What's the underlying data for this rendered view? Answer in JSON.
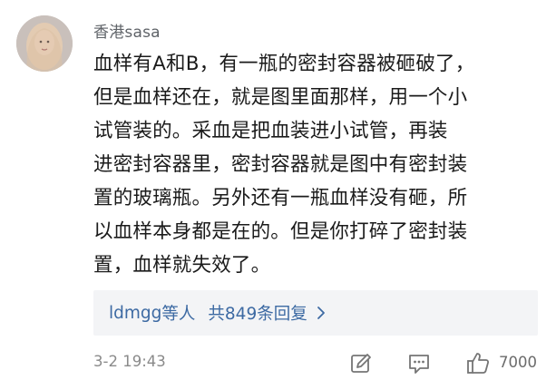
{
  "comment": {
    "username": "香港sasa",
    "lines": [
      "血样有A和B，有一瓶的密封容器被砸破了，",
      "但是血样还在，就是图里面那样，用一个小",
      "试管装的。采血是把血装进小试管，再装",
      "进密封容器里，密封容器就是图中有密封装",
      "置的玻璃瓶。另外还有一瓶血样没有砸，所",
      "以血样本身都是在的。但是你打碎了密封装",
      "置，血样就失效了。"
    ],
    "replies": {
      "names": "ldmgg",
      "names_suffix": "等人",
      "count_label": "共849条回复"
    },
    "timestamp": "3-2 19:43",
    "like_count": "7000"
  },
  "icons": {
    "avatar": "user-avatar",
    "edit": "edit-icon",
    "comment": "comment-icon",
    "like": "thumbs-up-icon",
    "chevron": "chevron-right-icon"
  },
  "colors": {
    "link": "#3d6aa3",
    "meta": "#8a8a8a",
    "panel": "#f3f4f6"
  }
}
